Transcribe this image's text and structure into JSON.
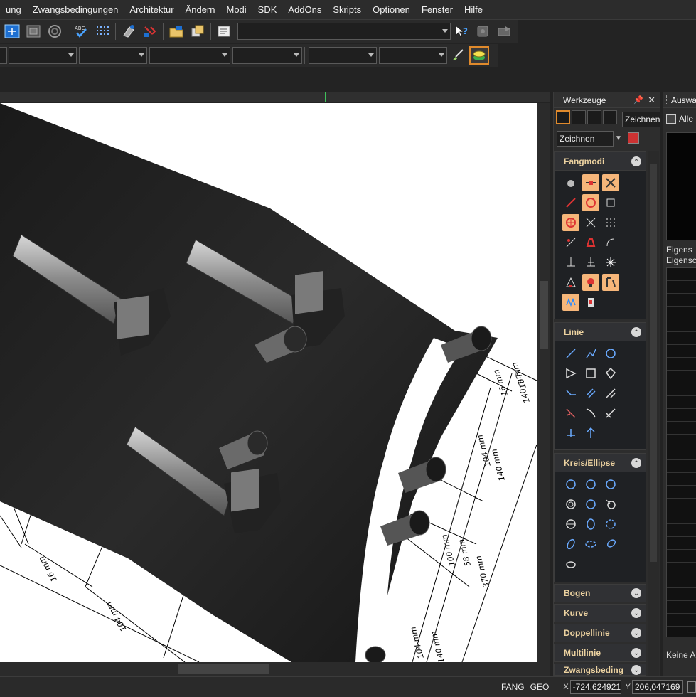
{
  "menu": [
    "ung",
    "Zwangsbedingungen",
    "Architektur",
    "Ändern",
    "Modi",
    "SDK",
    "AddOns",
    "Skripts",
    "Optionen",
    "Fenster",
    "Hilfe"
  ],
  "toolbar_icons": [
    "zoom-window-icon",
    "layout-icon",
    "render-icon",
    "spellcheck-icon",
    "grid-icon",
    "move-icon",
    "tool-icon",
    "open-folder-icon",
    "copy-icon",
    "properties-icon",
    "help-cursor-icon",
    "disk-icon",
    "send-icon"
  ],
  "werkzeuge": {
    "title": "Werkzeuge",
    "pin": "📌",
    "close": "✕",
    "mode_combo": "Zeichnen",
    "zeichnen_combo": "Zeichnen"
  },
  "sections": {
    "fangmodi": "Fangmodi",
    "linie": "Linie",
    "kreis": "Kreis/Ellipse",
    "bogen": "Bogen",
    "kurve": "Kurve",
    "doppellinie": "Doppellinie",
    "multilinie": "Multilinie",
    "zwang": "Zwangsbeding"
  },
  "auswahl": {
    "title": "Auswa",
    "all_label": "Alle",
    "tab1": "Eigens",
    "tab2": "Eigensc",
    "footer": "Keine A"
  },
  "status": {
    "fang": "FANG",
    "geo": "GEO",
    "x_label": "X",
    "x_value": "-724,624921",
    "y_label": "Y",
    "y_value": "206,047169 n"
  },
  "dimensions": {
    "d1": "16 mm",
    "d2": "104 mm",
    "d3": "16 mm",
    "d4": "104 mm",
    "d5": "140 mm",
    "d6": "140 mm",
    "d7": "100 mm",
    "d8": "58 mm",
    "d9": "370 mm",
    "d10": "104 mm",
    "d11": "16 mm",
    "d12": "140 mm"
  },
  "colors": {
    "accent": "#e08a2c",
    "highlight": "#f6b67a",
    "section_title": "#ecd2a0",
    "background": "#232323"
  }
}
